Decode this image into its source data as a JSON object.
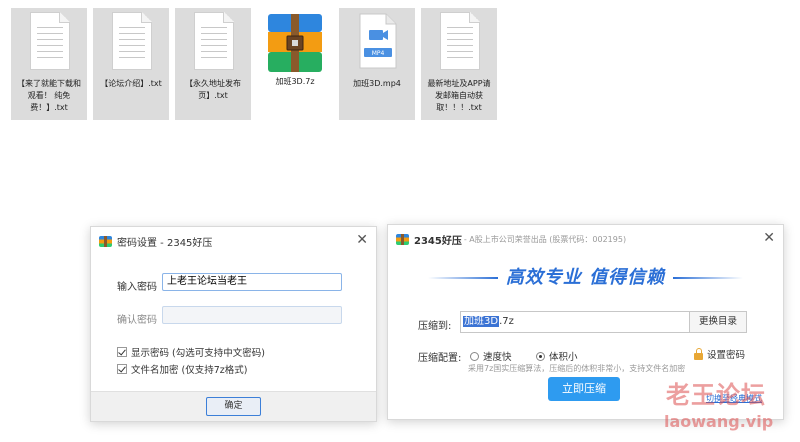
{
  "files": [
    {
      "name": "【来了就能下载和观看！ 纯免费！】.txt",
      "type": "txt",
      "selected": true
    },
    {
      "name": "【论坛介绍】.txt",
      "type": "txt",
      "selected": true
    },
    {
      "name": "【永久地址发布页】.txt",
      "type": "txt",
      "selected": true
    },
    {
      "name": "加班3D.7z",
      "type": "archive",
      "selected": false
    },
    {
      "name": "加班3D.mp4",
      "type": "video",
      "selected": true
    },
    {
      "name": "最新地址及APP请发邮箱自动获取！！！.txt",
      "type": "txt",
      "selected": true
    }
  ],
  "password_dialog": {
    "title": "密码设置 - 2345好压",
    "password_label": "输入密码",
    "password_value": "上老王论坛当老王",
    "confirm_label": "确认密码",
    "confirm_value": "",
    "show_password_label": "显示密码 (勾选可支持中文密码)",
    "show_password_checked": true,
    "encrypt_names_label": "文件名加密 (仅支持7z格式)",
    "encrypt_names_checked": true,
    "ok_label": "确定"
  },
  "compress_dialog": {
    "title": "2345好压",
    "subtitle": "- A股上市公司荣誉出品 (股票代码：002195)",
    "slogan": "高效专业 值得信赖",
    "target_label": "压缩到:",
    "target_highlight": "加班3D",
    "target_rest": ".7z",
    "change_dir_label": "更换目录",
    "config_label": "压缩配置:",
    "option_fast": "速度快",
    "option_small": "体积小",
    "selected_option": "体积小",
    "set_password_label": "设置密码",
    "description": "采用7z国实压缩算法，压缩后的体积非常小，支持文件名加密",
    "compress_button": "立即压缩",
    "advanced_link": "切换至经典模式"
  },
  "watermark": {
    "line1": "老王论坛",
    "line2": "laowang.vip"
  },
  "colors": {
    "accent": "#2e9bf0",
    "slogan": "#2b6fd6",
    "highlight": "#3b73d4",
    "watermark": "#dc5050"
  }
}
